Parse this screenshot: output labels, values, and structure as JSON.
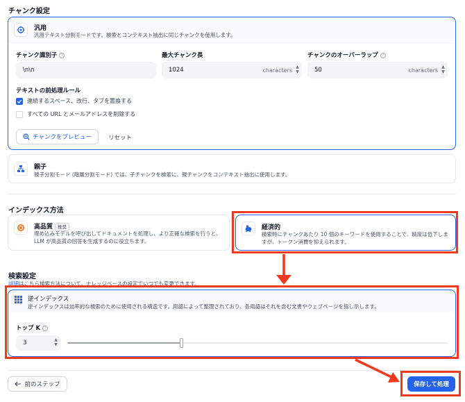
{
  "chunk_settings": {
    "title": "チャンク設定",
    "general": {
      "title": "汎用",
      "desc": "汎用テキスト分割モードです。検索とコンテキスト抽出に同じチャンクを使用します。",
      "delimiter_label": "チャンク識別子",
      "delimiter_value": "\\n\\n",
      "max_len_label": "最大チャンク長",
      "max_len_value": "1024",
      "overlap_label": "チャンクのオーバーラップ",
      "overlap_value": "50",
      "unit": "characters",
      "help": "?",
      "rules_label": "テキストの前処理ルール",
      "rule1": "連続するスペース、改行、タブを置換する",
      "rule1_checked": true,
      "rule2": "すべての URL とメールアドレスを削除する",
      "rule2_checked": false,
      "preview_button": "チャンクをプレビュー",
      "reset_button": "リセット"
    },
    "parent": {
      "title": "親子",
      "desc": "親子分割モード (階層分割モード) では、子チャンクを検索に、親チャンクをコンテキスト抽出に使用します。"
    }
  },
  "index_method": {
    "title": "インデックス方法",
    "high_quality": {
      "title": "高品質",
      "badge": "推奨",
      "desc": "埋め込みモデルを呼び出してドキュメントを処理し、より正確な検索を行うと、LLM が高品質の回答を生成するのに役立ちます。"
    },
    "economy": {
      "title": "経済的",
      "desc": "検索時にチャンクあたり 10 個のキーワードを使用することで、精度は低下しますが、トークン消費を抑えられます。"
    }
  },
  "retrieval": {
    "title": "検索設定",
    "note_link": "詳細",
    "note_rest": "はこちら検索方法について、ナレッジベースの設定でいつでも変更できます。",
    "inverted": {
      "title": "逆インデックス",
      "desc": "逆インデックスは効率的な検索のために使用される構造です。用語によって整理されており、各用語はそれを含む文書やウェブページを指し示します。"
    },
    "topk_label": "トップ K",
    "topk_value": "3",
    "topk_slider_value": 3,
    "topk_max": 10
  },
  "footer": {
    "back_button": "前のステップ",
    "save_button": "保存して処理"
  },
  "colors": {
    "accent": "#2563eb",
    "highlight": "#ef3a1d"
  }
}
